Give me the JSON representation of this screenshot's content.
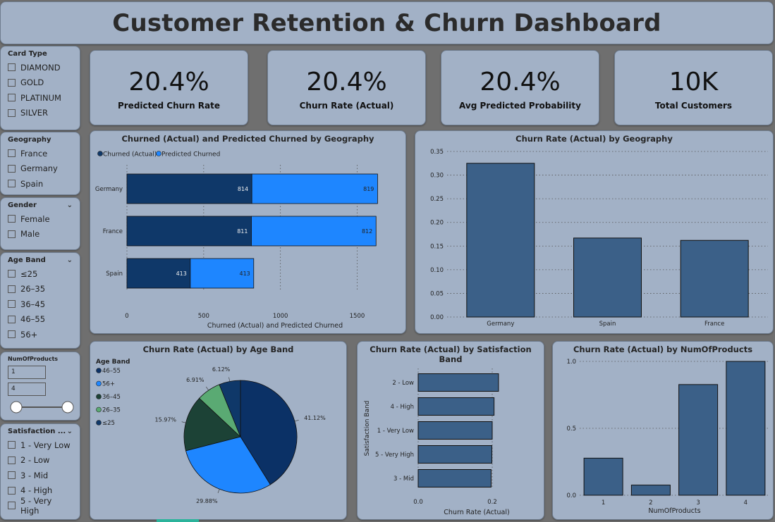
{
  "header": {
    "title": "Customer Retention & Churn Dashboard"
  },
  "slicers": {
    "card_type": {
      "title": "Card Type",
      "options": [
        "DIAMOND",
        "GOLD",
        "PLATINUM",
        "SILVER"
      ]
    },
    "geography": {
      "title": "Geography",
      "options": [
        "France",
        "Germany",
        "Spain"
      ]
    },
    "gender": {
      "title": "Gender",
      "options": [
        "Female",
        "Male"
      ]
    },
    "age_band": {
      "title": "Age Band",
      "options": [
        "≤25",
        "26–35",
        "36–45",
        "46–55",
        "56+"
      ]
    },
    "num_products": {
      "title": "NumOfProducts",
      "min": "1",
      "max": "4"
    },
    "satisfaction": {
      "title": "Satisfaction ...",
      "options": [
        "1 - Very Low",
        "2 - Low",
        "3 - Mid",
        "4 - High",
        "5 - Very High"
      ]
    }
  },
  "kpis": [
    {
      "value": "20.4%",
      "label": "Predicted Churn Rate"
    },
    {
      "value": "20.4%",
      "label": "Churn Rate (Actual)"
    },
    {
      "value": "20.4%",
      "label": "Avg Predicted Probability"
    },
    {
      "value": "10K",
      "label": "Total Customers"
    }
  ],
  "colors": {
    "dark_navy": "#0f3869",
    "bright_blue": "#1e86ff",
    "steel_bar": "#3b6088",
    "pie_dark_teal": "#1c4236",
    "pie_green": "#5aaa73",
    "pie_navy2": "#0b3166",
    "card_bg": "#a2b1c6"
  },
  "chart_data": [
    {
      "id": "stacked_geo",
      "type": "bar",
      "orientation": "horizontal-stacked",
      "title": "Churned (Actual) and Predicted Churned by Geography",
      "categories": [
        "Germany",
        "France",
        "Spain"
      ],
      "series": [
        {
          "name": "Churned (Actual)",
          "values": [
            814,
            811,
            413
          ]
        },
        {
          "name": "Predicted Churned",
          "values": [
            819,
            812,
            413
          ]
        }
      ],
      "xlabel": "Churned (Actual) and Predicted Churned",
      "xlim": [
        0,
        1700
      ],
      "xticks": [
        "0",
        "500",
        "1000",
        "1500"
      ],
      "legend": "top-left",
      "grid": true
    },
    {
      "id": "rate_geo",
      "type": "bar",
      "title": "Churn Rate (Actual) by Geography",
      "categories": [
        "Germany",
        "Spain",
        "France"
      ],
      "values": [
        0.325,
        0.167,
        0.162
      ],
      "ylim": [
        0,
        0.35
      ],
      "yticks": [
        "0.00",
        "0.05",
        "0.10",
        "0.15",
        "0.20",
        "0.25",
        "0.30",
        "0.35"
      ],
      "grid": true
    },
    {
      "id": "age_pie",
      "type": "pie",
      "title": "Churn Rate (Actual) by Age Band",
      "legend_title": "Age Band",
      "legend": "left",
      "legend_entries": [
        "46–55",
        "56+",
        "36–45",
        "26–35",
        "≤25"
      ],
      "slices": [
        {
          "label": "46–55",
          "value": 41.12,
          "text": "41.12%"
        },
        {
          "label": "56+",
          "value": 29.88,
          "text": "29.88%"
        },
        {
          "label": "36–45",
          "value": 15.97,
          "text": "15.97%"
        },
        {
          "label": "26–35",
          "value": 6.91,
          "text": "6.91%"
        },
        {
          "label": "≤25",
          "value": 6.12,
          "text": "6.12%"
        }
      ]
    },
    {
      "id": "rate_satisfaction",
      "type": "bar",
      "orientation": "horizontal",
      "title": "Churn Rate (Actual) by Satisfaction Band",
      "categories": [
        "2 - Low",
        "4 - High",
        "1 - Very Low",
        "5 - Very High",
        "3 - Mid"
      ],
      "values": [
        0.217,
        0.205,
        0.2,
        0.199,
        0.197
      ],
      "xlabel": "Churn Rate (Actual)",
      "ylabel": "Satisfaction Band",
      "xlim": [
        0,
        0.24
      ],
      "xticks": [
        "0.0",
        "0.2"
      ],
      "grid": true
    },
    {
      "id": "rate_products",
      "type": "bar",
      "title": "Churn Rate (Actual) by NumOfProducts",
      "categories": [
        "1",
        "2",
        "3",
        "4"
      ],
      "values": [
        0.277,
        0.076,
        0.827,
        1.0
      ],
      "xlabel": "NumOfProducts",
      "ylim": [
        0,
        1.0
      ],
      "yticks": [
        "0.0",
        "0.5",
        "1.0"
      ],
      "grid": true
    }
  ]
}
